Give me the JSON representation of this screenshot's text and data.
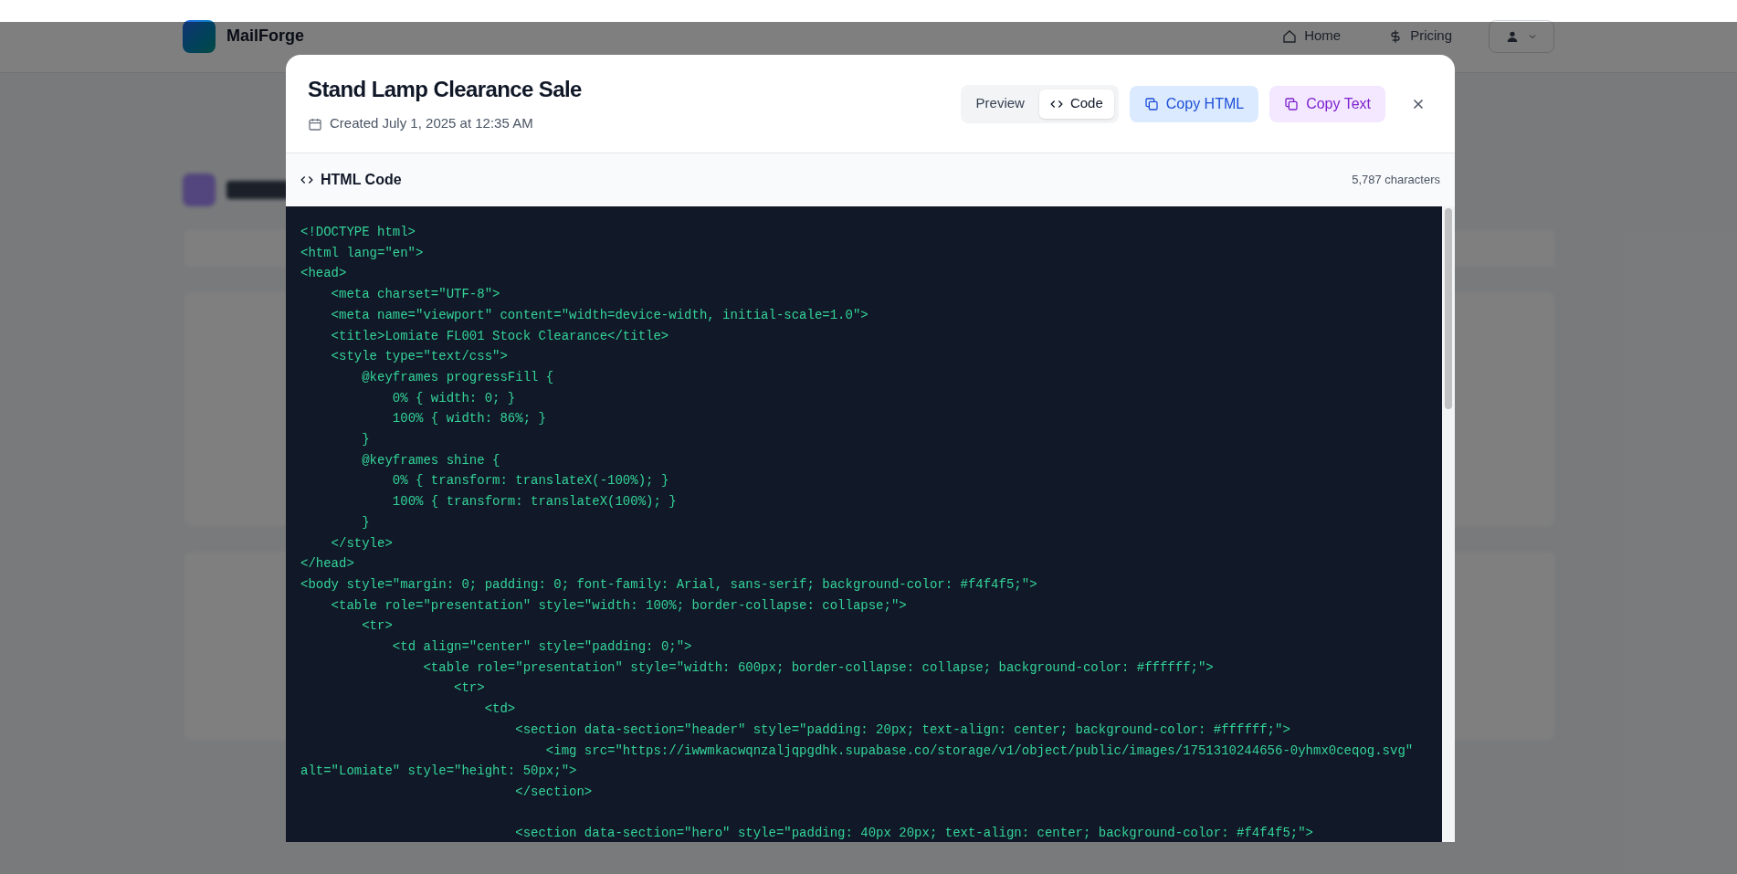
{
  "app_header": {
    "brand": "MailForge",
    "nav": [
      {
        "label": "Home",
        "kind": "home"
      },
      {
        "label": "Pricing",
        "kind": "pricing"
      }
    ]
  },
  "modal": {
    "title": "Stand Lamp Clearance Sale",
    "created": "Created July 1, 2025 at 12:35 AM",
    "view_tabs": [
      {
        "label": "Preview",
        "selected": false,
        "kind": "preview"
      },
      {
        "label": "Code",
        "selected": true,
        "kind": "code"
      }
    ],
    "actions": [
      {
        "label": "Copy HTML",
        "kind": "html"
      },
      {
        "label": "Copy Text",
        "kind": "text"
      }
    ],
    "code_panel": {
      "title": "HTML Code",
      "count": "5,787 characters",
      "code": "<!DOCTYPE html>\n<html lang=\"en\">\n<head>\n    <meta charset=\"UTF-8\">\n    <meta name=\"viewport\" content=\"width=device-width, initial-scale=1.0\">\n    <title>Lomiate FL001 Stock Clearance</title>\n    <style type=\"text/css\">\n        @keyframes progressFill {\n            0% { width: 0; }\n            100% { width: 86%; }\n        }\n        @keyframes shine {\n            0% { transform: translateX(-100%); }\n            100% { transform: translateX(100%); }\n        }\n    </style>\n</head>\n<body style=\"margin: 0; padding: 0; font-family: Arial, sans-serif; background-color: #f4f4f5;\">\n    <table role=\"presentation\" style=\"width: 100%; border-collapse: collapse;\">\n        <tr>\n            <td align=\"center\" style=\"padding: 0;\">\n                <table role=\"presentation\" style=\"width: 600px; border-collapse: collapse; background-color: #ffffff;\">\n                    <tr>\n                        <td>\n                            <section data-section=\"header\" style=\"padding: 20px; text-align: center; background-color: #ffffff;\">\n                                <img src=\"https://iwwmkacwqnzaljqpgdhk.supabase.co/storage/v1/object/public/images/1751310244656-0yhmx0ceqog.svg\" alt=\"Lomiate\" style=\"height: 50px;\">\n                            </section>\n\n                            <section data-section=\"hero\" style=\"padding: 40px 20px; text-align: center; background-color: #f4f4f5;\">"
    }
  }
}
